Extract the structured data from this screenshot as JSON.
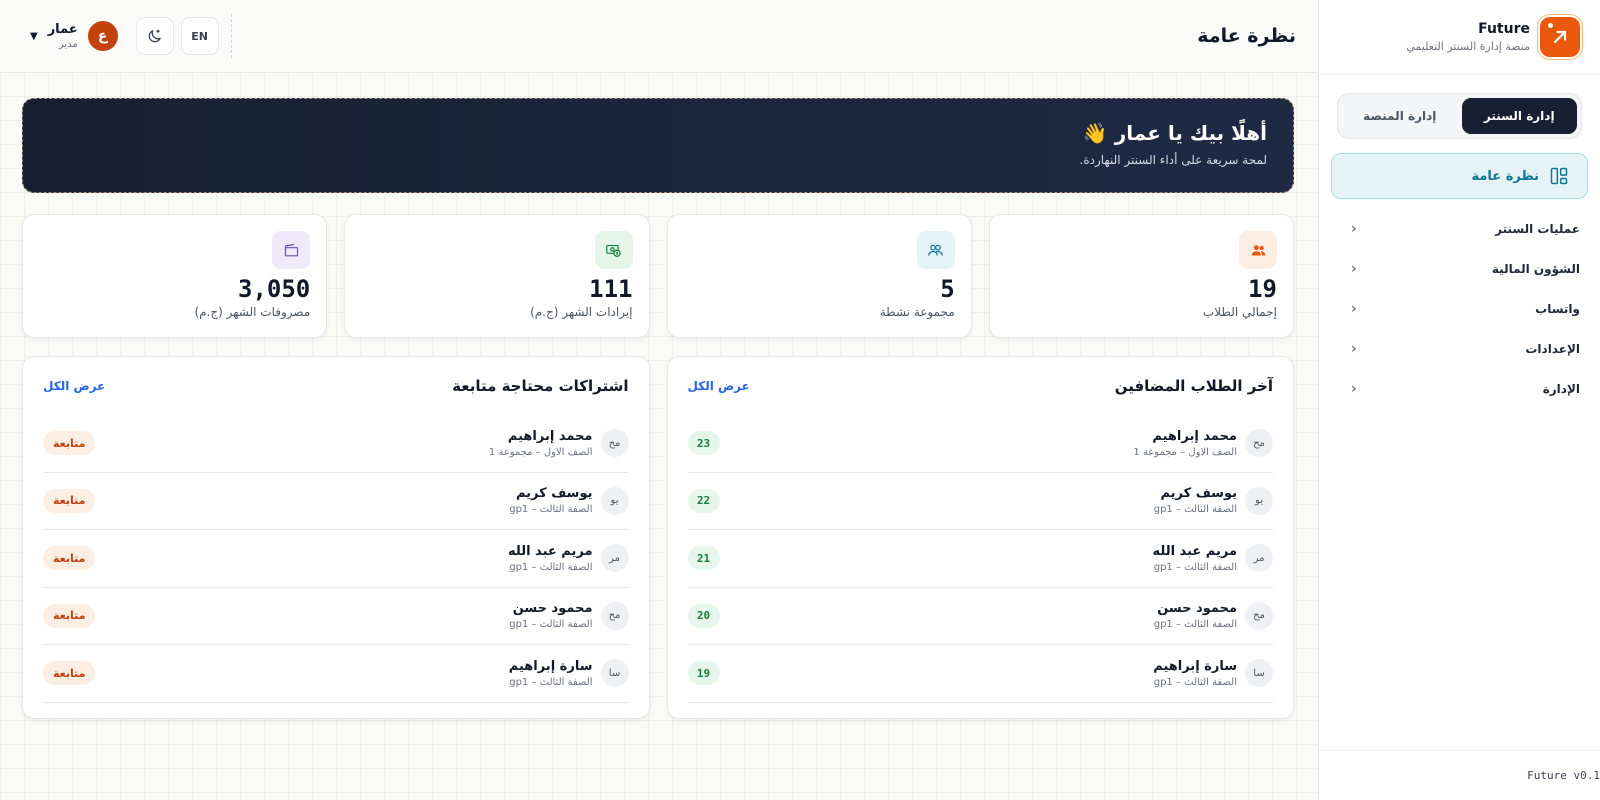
{
  "brand": {
    "name": "Future",
    "subtitle": "منصة إدارة السنتر التعليمي",
    "version": "Future v0.1"
  },
  "sidebar": {
    "segments": [
      {
        "label": "إدارة السنتر",
        "active": true
      },
      {
        "label": "إدارة المنصة",
        "active": false
      }
    ],
    "active_item": {
      "label": "نظرة عامة",
      "icon": "layout-icon"
    },
    "items": [
      {
        "label": "عمليات السنتر"
      },
      {
        "label": "الشؤون المالية"
      },
      {
        "label": "واتساب"
      },
      {
        "label": "الإعدادات"
      },
      {
        "label": "الإدارة"
      }
    ]
  },
  "header": {
    "title": "نظرة عامة",
    "lang_button": "EN",
    "user": {
      "name": "عمار",
      "role": "مدير",
      "avatar_letter": "ع"
    }
  },
  "welcome": {
    "title": "أهلًا بيك يا عمار 👋",
    "subtitle": "لمحة سريعة على أداء السنتر النهاردة."
  },
  "stats": [
    {
      "value": "19",
      "label": "إجمالي الطلاب",
      "icon": "users-icon",
      "color": "#ea580c",
      "bg": "#fdeee4"
    },
    {
      "value": "5",
      "label": "مجموعة نشطة",
      "icon": "groups-icon",
      "color": "#0e7490",
      "bg": "#e3f4f7"
    },
    {
      "value": "111",
      "label": "إيرادات الشهر (ج.م)",
      "icon": "money-icon",
      "color": "#15803d",
      "bg": "#e5f5e9"
    },
    {
      "value": "3,050",
      "label": "مصروفات الشهر (ج.م)",
      "icon": "wallet-icon",
      "color": "#6d4fc2",
      "bg": "#efeafb"
    }
  ],
  "recent_students": {
    "title": "آخر الطلاب المضافين",
    "view_all": "عرض الكل",
    "rows": [
      {
        "initials": "مح",
        "name": "محمد إبراهيم",
        "sub": "الصف الاول – مجموعة 1",
        "badge": "23"
      },
      {
        "initials": "يو",
        "name": "يوسف كريم",
        "sub": "الصفة الثالث – gp1",
        "badge": "22"
      },
      {
        "initials": "مر",
        "name": "مريم عبد الله",
        "sub": "الصفة الثالث – gp1",
        "badge": "21"
      },
      {
        "initials": "مح",
        "name": "محمود حسن",
        "sub": "الصفة الثالث – gp1",
        "badge": "20"
      },
      {
        "initials": "سا",
        "name": "سارة إبراهيم",
        "sub": "الصفة الثالث – gp1",
        "badge": "19"
      }
    ]
  },
  "followups": {
    "title": "اشتراكات محتاجة متابعة",
    "view_all": "عرض الكل",
    "rows": [
      {
        "initials": "مح",
        "name": "محمد إبراهيم",
        "sub": "الصف الاول – مجموعة 1",
        "badge": "متابعة"
      },
      {
        "initials": "يو",
        "name": "يوسف كريم",
        "sub": "الصفة الثالث – gp1",
        "badge": "متابعة"
      },
      {
        "initials": "مر",
        "name": "مريم عبد الله",
        "sub": "الصفة الثالث – gp1",
        "badge": "متابعة"
      },
      {
        "initials": "مح",
        "name": "محمود حسن",
        "sub": "الصفة الثالث – gp1",
        "badge": "متابعة"
      },
      {
        "initials": "سا",
        "name": "سارة إبراهيم",
        "sub": "الصفة الثالث – gp1",
        "badge": "متابعة"
      }
    ]
  }
}
